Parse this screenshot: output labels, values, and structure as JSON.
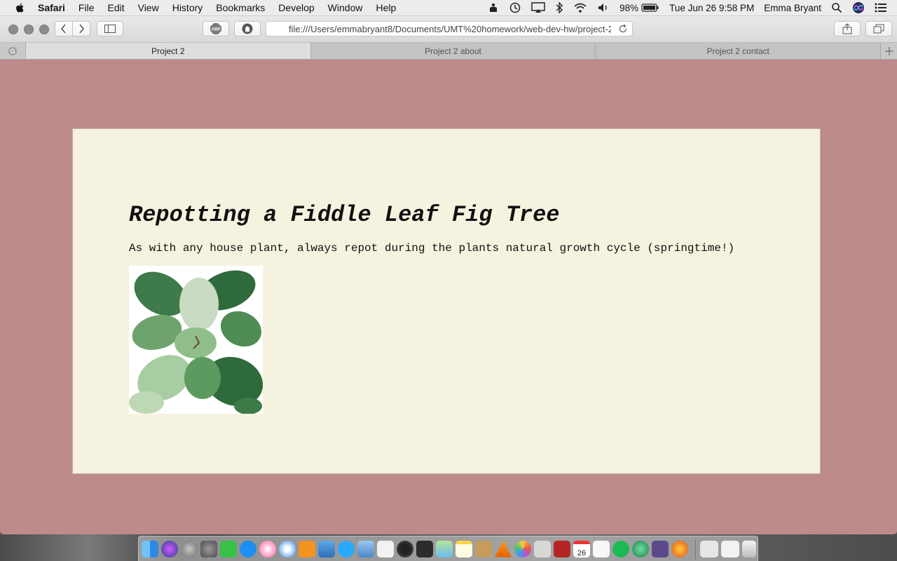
{
  "menubar": {
    "app_name": "Safari",
    "menus": [
      "File",
      "Edit",
      "View",
      "History",
      "Bookmarks",
      "Develop",
      "Window",
      "Help"
    ],
    "battery": "98%",
    "datetime": "Tue Jun 26  9:58 PM",
    "user": "Emma Bryant"
  },
  "toolbar": {
    "url": "file:///Users/emmabryant8/Documents/UMT%20homework/web-dev-hw/project-2"
  },
  "tabs": [
    {
      "label": "Project 2",
      "active": true
    },
    {
      "label": "Project 2 about",
      "active": false
    },
    {
      "label": "Project 2 contact",
      "active": false
    }
  ],
  "page": {
    "heading": "Repotting a Fiddle Leaf Fig Tree",
    "text": "As with any house plant, always repot during the plants natural growth cycle (springtime!)",
    "background_color": "#bd8b8c",
    "card_color": "#f5f2df"
  },
  "dock": {
    "icons": [
      "finder-icon",
      "siri-icon",
      "launchpad-icon",
      "system-preferences-icon",
      "facetime-icon",
      "app-store-icon",
      "itunes-icon",
      "safari-icon",
      "ibooks-icon",
      "migration-icon",
      "messages-icon",
      "preview-icon",
      "textedit-icon",
      "photo-booth-icon",
      "mission-control-icon",
      "maps-icon",
      "notes-icon",
      "archive-icon",
      "vlc-icon",
      "photos-icon",
      "help-icon",
      "photo-app-icon",
      "calendar-icon",
      "reminders-icon",
      "spotify-icon",
      "atom-icon",
      "github-icon",
      "firefox-icon"
    ],
    "calendar_day": "26"
  }
}
